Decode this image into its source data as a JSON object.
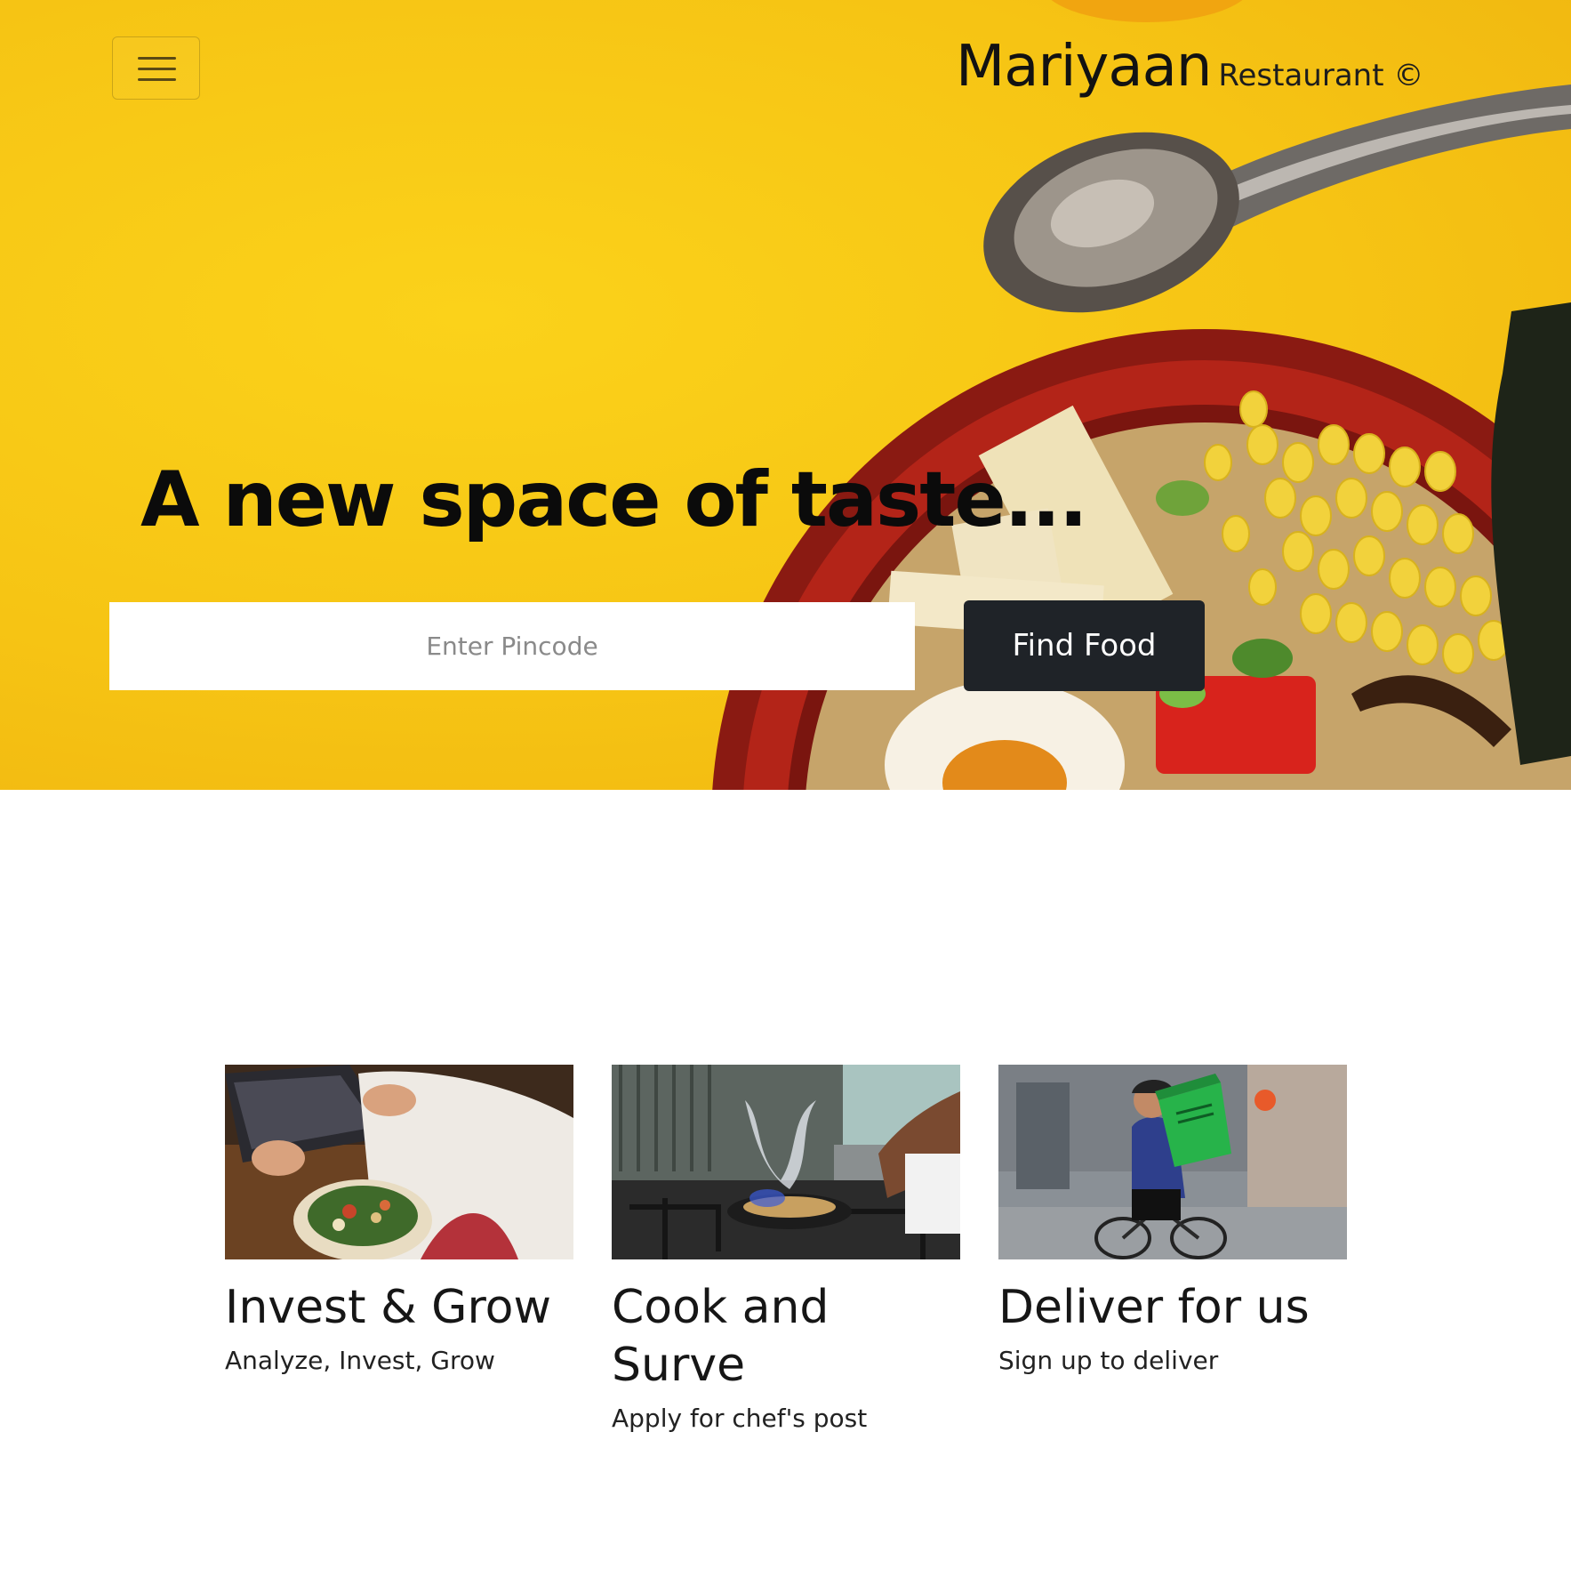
{
  "header": {
    "brand_name": "Mariyaan",
    "brand_suffix": "Restaurant ©",
    "menu_icon": "hamburger-menu-icon"
  },
  "hero": {
    "headline": "A new space of taste...",
    "pincode_placeholder": "Enter Pincode",
    "find_button_label": "Find Food"
  },
  "cards": [
    {
      "title": "Invest & Grow",
      "subtitle": "Analyze, Invest, Grow"
    },
    {
      "title": "Cook and Surve",
      "subtitle": "Apply for chef's post"
    },
    {
      "title": "Deliver for us",
      "subtitle": "Sign up to deliver"
    }
  ],
  "colors": {
    "hero_background": "#f6c414",
    "button_dark": "#1f2328",
    "page_background": "#ffffff"
  }
}
